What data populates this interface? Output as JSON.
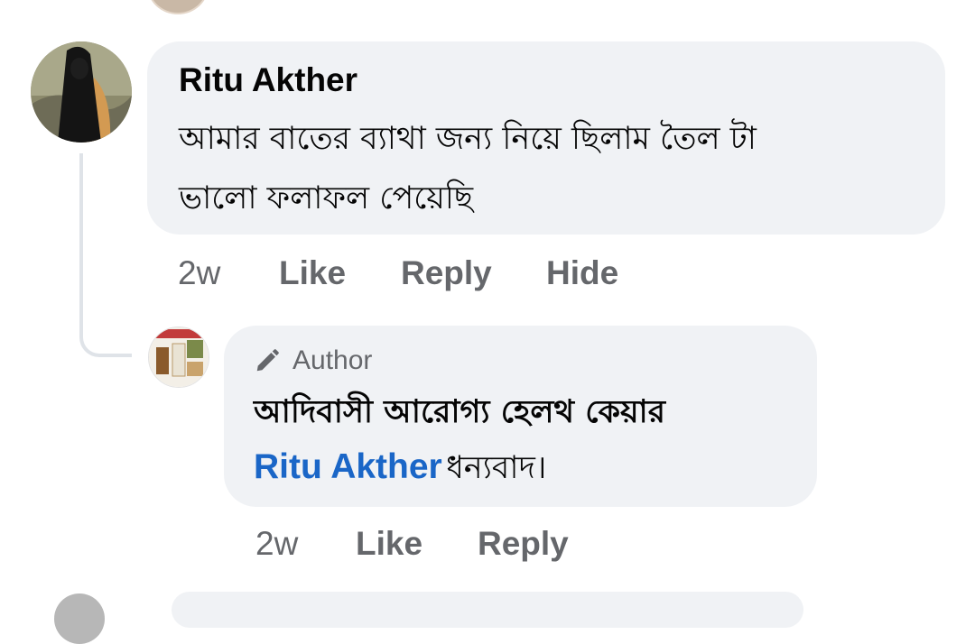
{
  "comment": {
    "author": "Ritu Akther",
    "text_line1": "আমার বাতের ব্যাথা জন্য নিয়ে ছিলাম তৈল টা",
    "text_line2": "ভালো ফলাফল পেয়েছি",
    "time": "2w",
    "actions": {
      "like": "Like",
      "reply": "Reply",
      "hide": "Hide"
    }
  },
  "reply": {
    "badge": "Author",
    "author": "আদিবাসী আরোগ্য হেলথ কেয়ার",
    "mention": "Ritu Akther",
    "text": "ধন্যবাদ।",
    "time": "2w",
    "actions": {
      "like": "Like",
      "reply": "Reply"
    }
  },
  "colors": {
    "bubble": "#f0f2f5",
    "mention": "#1a66c7",
    "meta": "#65676b",
    "thread_line": "#dfe3e8"
  }
}
